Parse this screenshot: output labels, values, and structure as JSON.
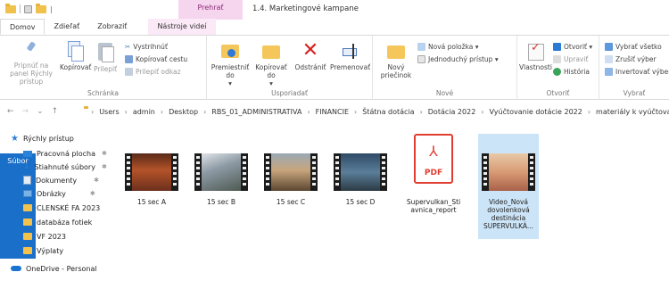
{
  "window": {
    "title": "1.4. Marketingové kampane",
    "context_tab": "Prehrať",
    "quick_access_sep": "|"
  },
  "tabs": [
    {
      "label": "Súbor"
    },
    {
      "label": "Domov"
    },
    {
      "label": "Zdieľať"
    },
    {
      "label": "Zobraziť"
    },
    {
      "label": "Nástroje videí"
    }
  ],
  "ribbon": {
    "clipboard": {
      "group_label": "Schránka",
      "pin": "Pripnúť na panel Rýchly prístup",
      "copy": "Kopírovať",
      "paste": "Prilepiť",
      "cut": "Vystrihnúť",
      "copy_path": "Kopírovať cestu",
      "paste_shortcut": "Prilepiť odkaz"
    },
    "organize": {
      "group_label": "Usporiadať",
      "move_to": "Premiestniť do",
      "copy_to": "Kopírovať do",
      "delete": "Odstrániť",
      "rename": "Premenovať",
      "dropdown": "▾"
    },
    "new": {
      "group_label": "Nové",
      "new_folder": "Nový priečinok",
      "new_item": "Nová položka ▾",
      "easy_access": "Jednoduchý prístup ▾"
    },
    "open": {
      "group_label": "Otvoriť",
      "properties": "Vlastnosti",
      "open": "Otvoriť ▾",
      "edit": "Upraviť",
      "history": "História"
    },
    "select": {
      "group_label": "Vybrať",
      "select_all": "Vybrať všetko",
      "select_none": "Zrušiť výber",
      "invert": "Invertovať výber"
    }
  },
  "nav": {
    "back": "←",
    "forward": "→",
    "recent": "⌄",
    "up": "↑"
  },
  "address": {
    "sep": "›",
    "crumbs": [
      "Users",
      "admin",
      "Desktop",
      "RBS_01_ADMINISTRATIVA",
      "FINANCIE",
      "Štátna dotácia",
      "Dotácia 2022",
      "Vyúčtovanie dotácie 2022",
      "materiály k vyúčtovaniu"
    ]
  },
  "navpane": {
    "pin_glyph": "✱",
    "items": [
      {
        "label": "Rýchly prístup"
      },
      {
        "label": "Pracovná plocha"
      },
      {
        "label": "Stiahnuté súbory"
      },
      {
        "label": "Dokumenty"
      },
      {
        "label": "Obrázky"
      },
      {
        "label": "CLENSKÉ FA 2023"
      },
      {
        "label": "databáza fotiek"
      },
      {
        "label": "VF 2023"
      },
      {
        "label": "Výplaty"
      },
      {
        "label": "OneDrive - Personal"
      }
    ]
  },
  "files": [
    {
      "name": "15 sec A"
    },
    {
      "name": "15 sec B"
    },
    {
      "name": "15 sec C"
    },
    {
      "name": "15 sec D"
    },
    {
      "name": "Supervulkan_Stiavnica_report",
      "pdf_label": "PDF",
      "pdf_glyph": "⅄"
    },
    {
      "name": "Video_Nová dovolenková destinácia SUPERVULKÁ..."
    }
  ],
  "colors": {
    "accent": "#1a6fc9",
    "context_tab": "#f6d6ef",
    "selection": "#cce4f7",
    "pdf_red": "#e13d31"
  }
}
